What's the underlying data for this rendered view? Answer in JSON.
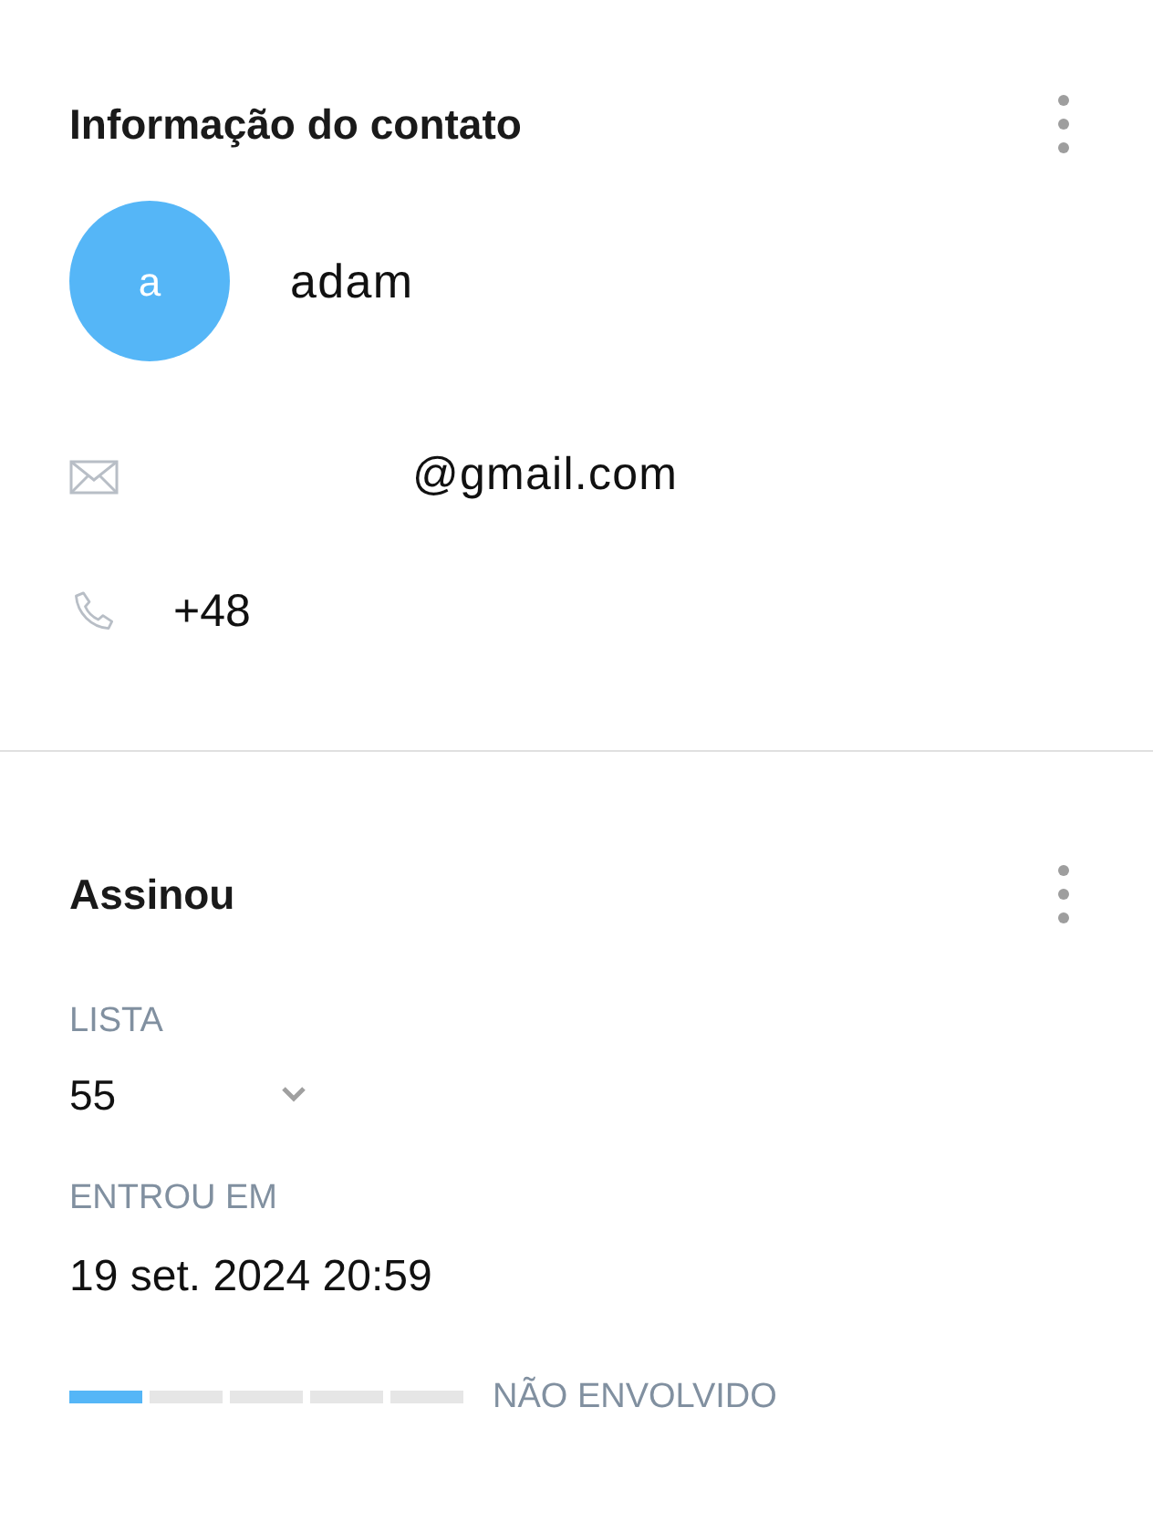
{
  "contact": {
    "title": "Informação do contato",
    "avatar_letter": "a",
    "name": "adam",
    "email": "@gmail.com",
    "phone": "+48"
  },
  "subscription": {
    "title": "Assinou",
    "list_label": "LISTA",
    "list_value": "55",
    "joined_label": "ENTROU EM",
    "joined_value": "19 set. 2024 20:59",
    "engagement": {
      "level": 0.2,
      "label": "NÃO ENVOLVIDO"
    }
  }
}
